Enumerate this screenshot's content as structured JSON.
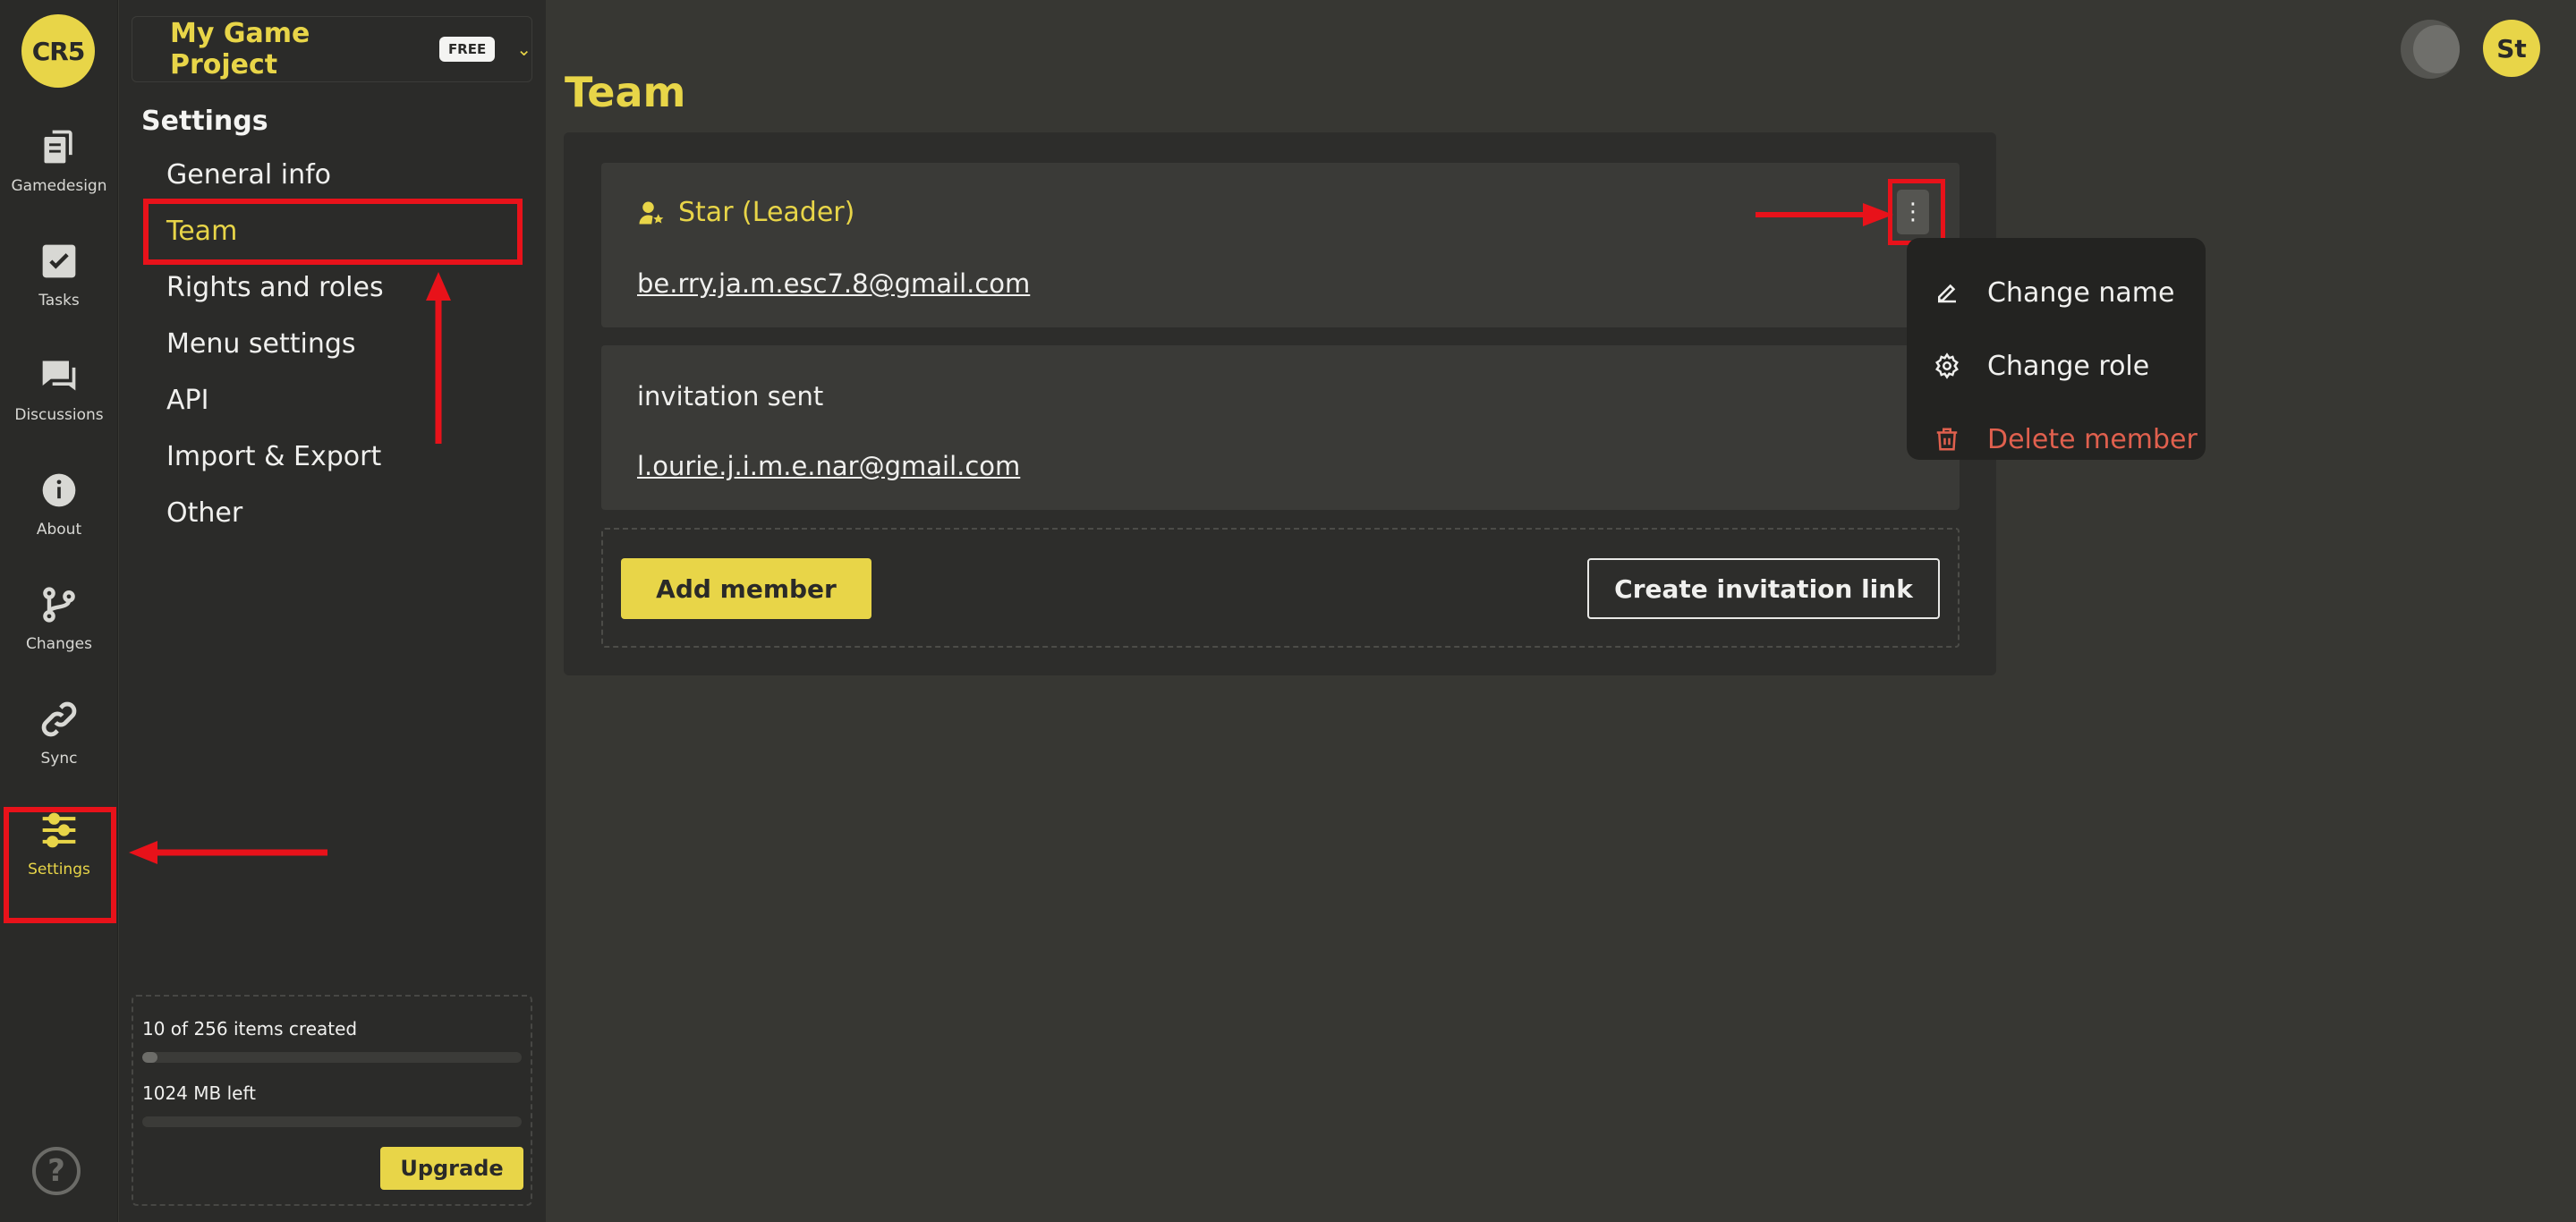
{
  "rail": {
    "logo": "CR5",
    "items": [
      {
        "label": "Gamedesign",
        "icon": "document-icon"
      },
      {
        "label": "Tasks",
        "icon": "checkbox-icon"
      },
      {
        "label": "Discussions",
        "icon": "chat-icon"
      },
      {
        "label": "About",
        "icon": "info-icon"
      },
      {
        "label": "Changes",
        "icon": "branch-icon"
      },
      {
        "label": "Sync",
        "icon": "link-icon"
      },
      {
        "label": "Settings",
        "icon": "sliders-icon"
      }
    ],
    "help": "?"
  },
  "sidebar": {
    "project_name": "My Game Project",
    "plan_badge": "FREE",
    "heading": "Settings",
    "items": [
      {
        "label": "General info"
      },
      {
        "label": "Team"
      },
      {
        "label": "Rights and roles"
      },
      {
        "label": "Menu settings"
      },
      {
        "label": "API"
      },
      {
        "label": "Import & Export"
      },
      {
        "label": "Other"
      }
    ],
    "usage": {
      "items_text": "10 of 256 items created",
      "items_fraction": 0.039,
      "storage_text": "1024 MB left",
      "storage_fraction": 0.0,
      "upgrade_label": "Upgrade"
    }
  },
  "main": {
    "title": "Team",
    "members": [
      {
        "name": "Star (Leader)",
        "email": "be.rry.ja.m.esc7.8@gmail.com"
      },
      {
        "status": "invitation sent",
        "email": "l.ourie.j.i.m.e.nar@gmail.com"
      }
    ],
    "add_member_label": "Add member",
    "create_link_label": "Create invitation link",
    "dropdown": [
      {
        "label": "Change name",
        "icon": "pencil-icon"
      },
      {
        "label": "Change role",
        "icon": "gear-icon"
      },
      {
        "label": "Delete member",
        "icon": "trash-icon"
      }
    ]
  },
  "header": {
    "avatar_initials": "St"
  },
  "colors": {
    "accent": "#e8d548",
    "danger": "#e0604e",
    "annotation": "#e8121a"
  }
}
